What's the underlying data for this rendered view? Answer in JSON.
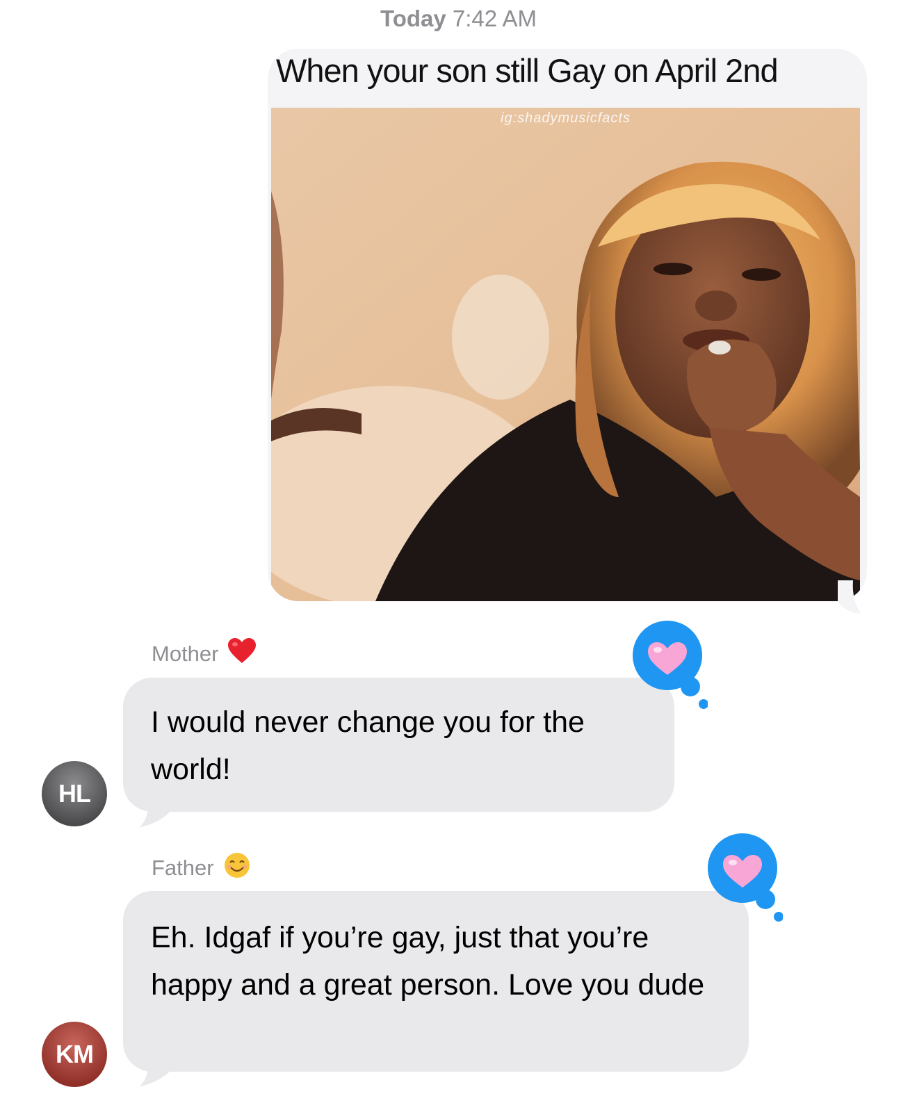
{
  "header": {
    "timestamp_day": "Today",
    "timestamp_time": "7:42 AM"
  },
  "outgoing_meme": {
    "caption": "When your son still Gay on April 2nd",
    "watermark": "ig:shadymusicfacts"
  },
  "messages": [
    {
      "sender_name": "Mother",
      "sender_emoji": "red-heart-icon",
      "avatar_initials": "HL",
      "text": "I would never change you for the world!",
      "tapback": "pink-heart-icon"
    },
    {
      "sender_name": "Father",
      "sender_emoji": "smiling-face-icon",
      "avatar_initials": "KM",
      "text": "Eh. Idgaf if you’re gay, just that you’re happy and a great person. Love you dude",
      "tapback": "pink-heart-icon"
    }
  ],
  "colors": {
    "incoming_bubble": "#e9e9eb",
    "tapback_blue": "#1e96f2",
    "label_gray": "#8e8e93"
  }
}
